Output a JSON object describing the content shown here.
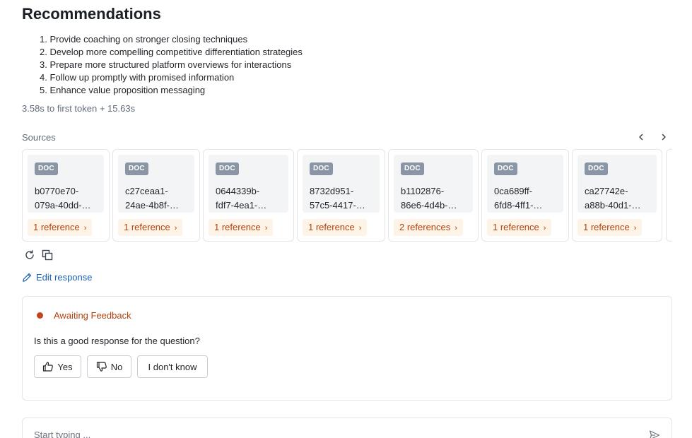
{
  "title": "Recommendations",
  "recommendations": [
    "1. Provide coaching on stronger closing techniques",
    "2. Develop more compelling competitive differentiation strategies",
    "3. Prepare more structured platform overviews for interactions",
    "4. Follow up promptly with promised information",
    "5. Enhance value proposition messaging"
  ],
  "timing": "3.58s to first token + 15.63s",
  "sources": {
    "label": "Sources",
    "badge": "DOC",
    "cards": [
      {
        "line1": "b0770e70-",
        "line2": "079a-40dd-…",
        "refs": "1 reference"
      },
      {
        "line1": "c27ceaa1-",
        "line2": "24ae-4b8f-…",
        "refs": "1 reference"
      },
      {
        "line1": "0644339b-",
        "line2": "fdf7-4ea1-…",
        "refs": "1 reference"
      },
      {
        "line1": "8732d951-",
        "line2": "57c5-4417-…",
        "refs": "1 reference"
      },
      {
        "line1": "b1102876-",
        "line2": "86e6-4d4b-…",
        "refs": "2 references"
      },
      {
        "line1": "0ca689ff-",
        "line2": "6fd8-4ff1-…",
        "refs": "1 reference"
      },
      {
        "line1": "ca27742e-",
        "line2": "a88b-40d1-…",
        "refs": "1 reference"
      }
    ]
  },
  "actions": {
    "edit_label": "Edit response"
  },
  "feedback": {
    "status": "Awaiting Feedback",
    "question": "Is this a good response for the question?",
    "yes": "Yes",
    "no": "No",
    "dont_know": "I don't know"
  },
  "input": {
    "placeholder": "Start typing ..."
  },
  "colors": {
    "accent": "#1a5fb4",
    "status": "#c4441c",
    "chip_bg": "#fdf3e7",
    "chip_text": "#b3420e"
  }
}
